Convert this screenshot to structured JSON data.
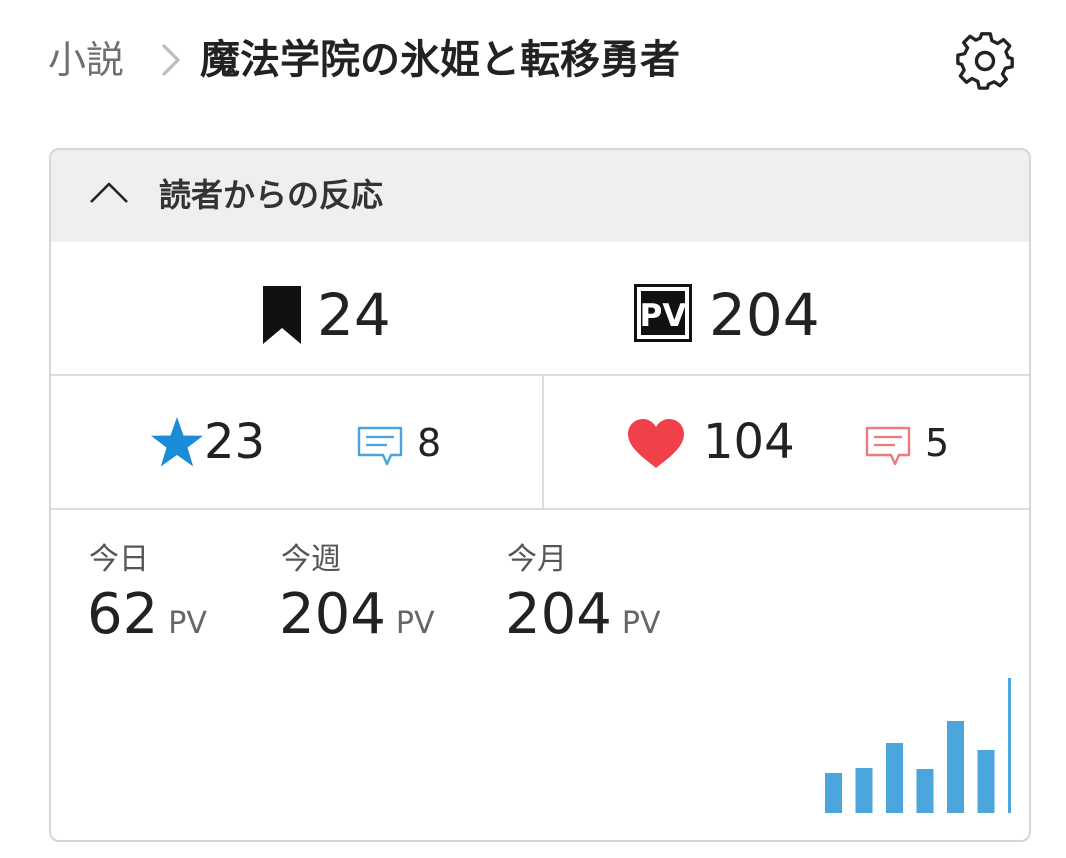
{
  "header": {
    "breadcrumb_parent": "小説",
    "title": "魔法学院の氷姫と転移勇者",
    "settings_icon": "gear-icon"
  },
  "reactions_panel": {
    "title": "読者からの反応",
    "collapse_icon": "chevron-up-icon",
    "bookmarks": {
      "icon": "bookmark-icon",
      "value": "24"
    },
    "page_views": {
      "icon": "pv-icon",
      "label": "PV",
      "value": "204"
    },
    "stars": {
      "icon": "star-icon",
      "value": "23",
      "color": "#1a8cd8"
    },
    "star_comments": {
      "icon": "comment-icon",
      "value": "8",
      "color": "#4aa3df"
    },
    "hearts": {
      "icon": "heart-icon",
      "value": "104",
      "color": "#f0414a"
    },
    "heart_comments": {
      "icon": "comment-icon",
      "value": "5",
      "color": "#ee7b7b"
    }
  },
  "pv_stats": {
    "unit": "PV",
    "today": {
      "label": "今日",
      "value": "62"
    },
    "week": {
      "label": "今週",
      "value": "204"
    },
    "month": {
      "label": "今月",
      "value": "204"
    }
  },
  "chart_data": {
    "type": "bar",
    "color": "#4aa6dc",
    "values": [
      40,
      45,
      70,
      44,
      92,
      63,
      135
    ]
  }
}
